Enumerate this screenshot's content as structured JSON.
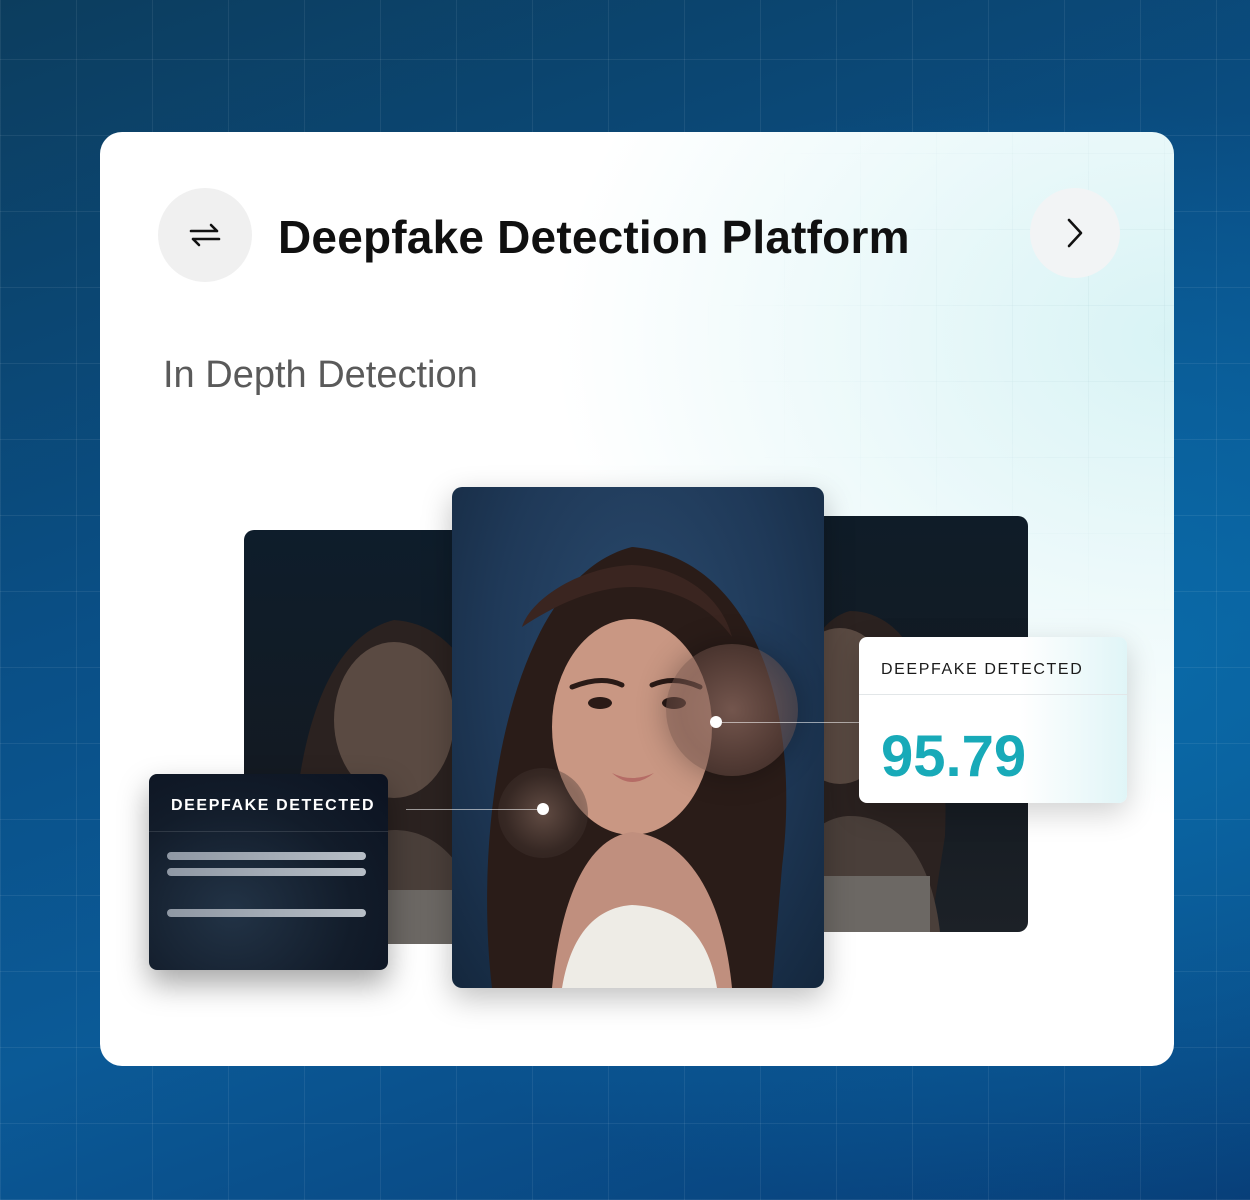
{
  "header": {
    "title": "Deepfake Detection Platform",
    "swap_icon": "swap-arrows-icon",
    "next_icon": "chevron-right-icon"
  },
  "subtitle": "In Depth Detection",
  "score_card": {
    "label": "DEEPFAKE DETECTED",
    "value": "95.79"
  },
  "dark_card": {
    "label": "DEEPFAKE DETECTED"
  },
  "colors": {
    "accent": "#18aab8",
    "background": "#0b5a97",
    "card": "#ffffff"
  }
}
